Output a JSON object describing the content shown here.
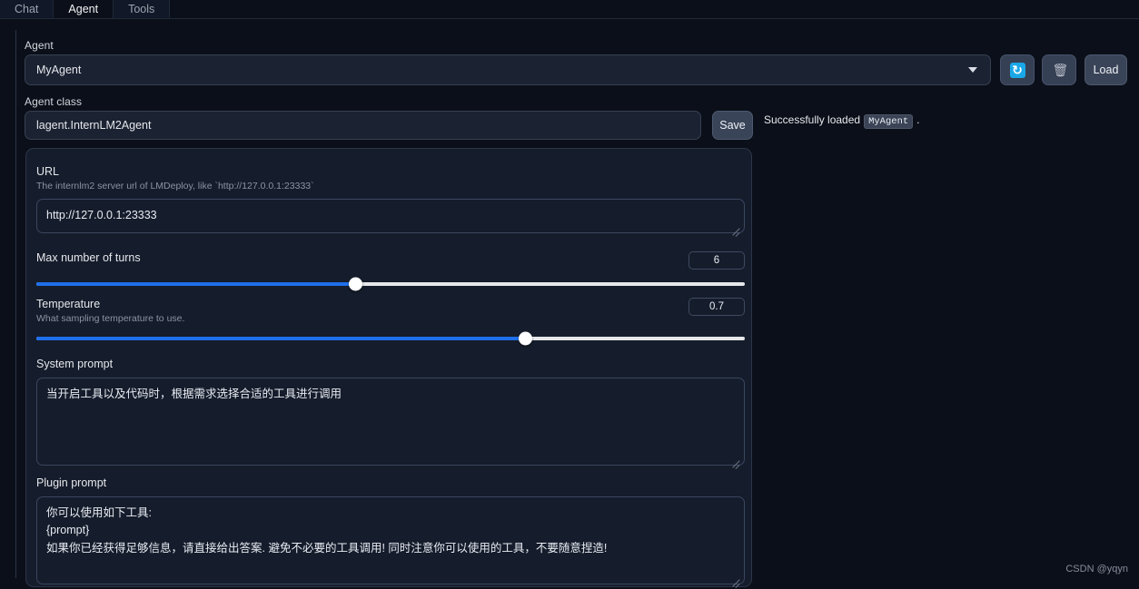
{
  "tabs": [
    {
      "label": "Chat",
      "active": false
    },
    {
      "label": "Agent",
      "active": true
    },
    {
      "label": "Tools",
      "active": false
    }
  ],
  "agent": {
    "label": "Agent",
    "selected": "MyAgent",
    "refresh_icon": "refresh-icon",
    "delete_icon": "trash-icon",
    "load_label": "Load"
  },
  "agent_class": {
    "label": "Agent class",
    "value": "lagent.InternLM2Agent",
    "save_label": "Save"
  },
  "status": {
    "prefix": "Successfully loaded",
    "code": "MyAgent",
    "suffix": "."
  },
  "url_field": {
    "title": "URL",
    "description": "The internlm2 server url of LMDeploy, like `http://127.0.0.1:23333`",
    "value": "http://127.0.0.1:23333"
  },
  "max_turns": {
    "title": "Max number of turns",
    "value": "6",
    "percent": 45
  },
  "temperature": {
    "title": "Temperature",
    "description": "What sampling temperature to use.",
    "value": "0.7",
    "percent": 69
  },
  "system_prompt": {
    "title": "System prompt",
    "value": "当开启工具以及代码时，根据需求选择合适的工具进行调用"
  },
  "plugin_prompt": {
    "title": "Plugin prompt",
    "value": "你可以使用如下工具:\n{prompt}\n如果你已经获得足够信息，请直接给出答案. 避免不必要的工具调用! 同时注意你可以使用的工具，不要随意捏造!"
  },
  "watermark": "CSDN @yqyn",
  "colors": {
    "accent": "#1f6feb",
    "page_bg": "#0b0f19",
    "panel_bg": "#151c2b",
    "input_bg": "#1b2232",
    "button_bg": "#3a4458"
  }
}
